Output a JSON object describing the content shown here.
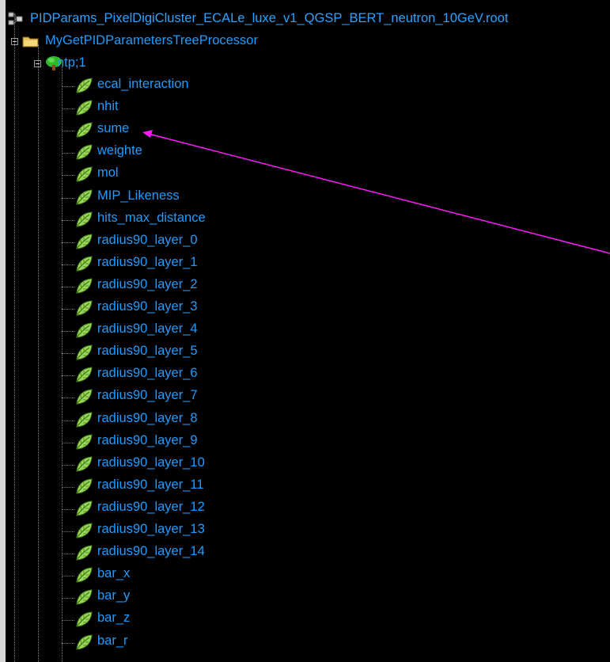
{
  "tree": {
    "root": {
      "label": "PIDParams_PixelDigiCluster_ECALe_luxe_v1_QGSP_BERT_neutron_10GeV.root",
      "icon": "root-file-icon"
    },
    "processor": {
      "label": "MyGetPIDParametersTreeProcessor",
      "icon": "folder-icon"
    },
    "ntuple": {
      "label": "ntp;1",
      "icon": "tree-icon"
    },
    "leaves": [
      "ecal_interaction",
      "nhit",
      "sume",
      "weighte",
      "mol",
      "MIP_Likeness",
      "hits_max_distance",
      "radius90_layer_0",
      "radius90_layer_1",
      "radius90_layer_2",
      "radius90_layer_3",
      "radius90_layer_4",
      "radius90_layer_5",
      "radius90_layer_6",
      "radius90_layer_7",
      "radius90_layer_8",
      "radius90_layer_9",
      "radius90_layer_10",
      "radius90_layer_11",
      "radius90_layer_12",
      "radius90_layer_13",
      "radius90_layer_14",
      "bar_x",
      "bar_y",
      "bar_z",
      "bar_r"
    ],
    "leaf_icon": "leaf-icon"
  },
  "annotation": {
    "color": "#ff19ff",
    "points_to": "sume"
  },
  "colors": {
    "label": "#1f9cff",
    "background": "#000000",
    "connector": "#7a7a7a"
  }
}
